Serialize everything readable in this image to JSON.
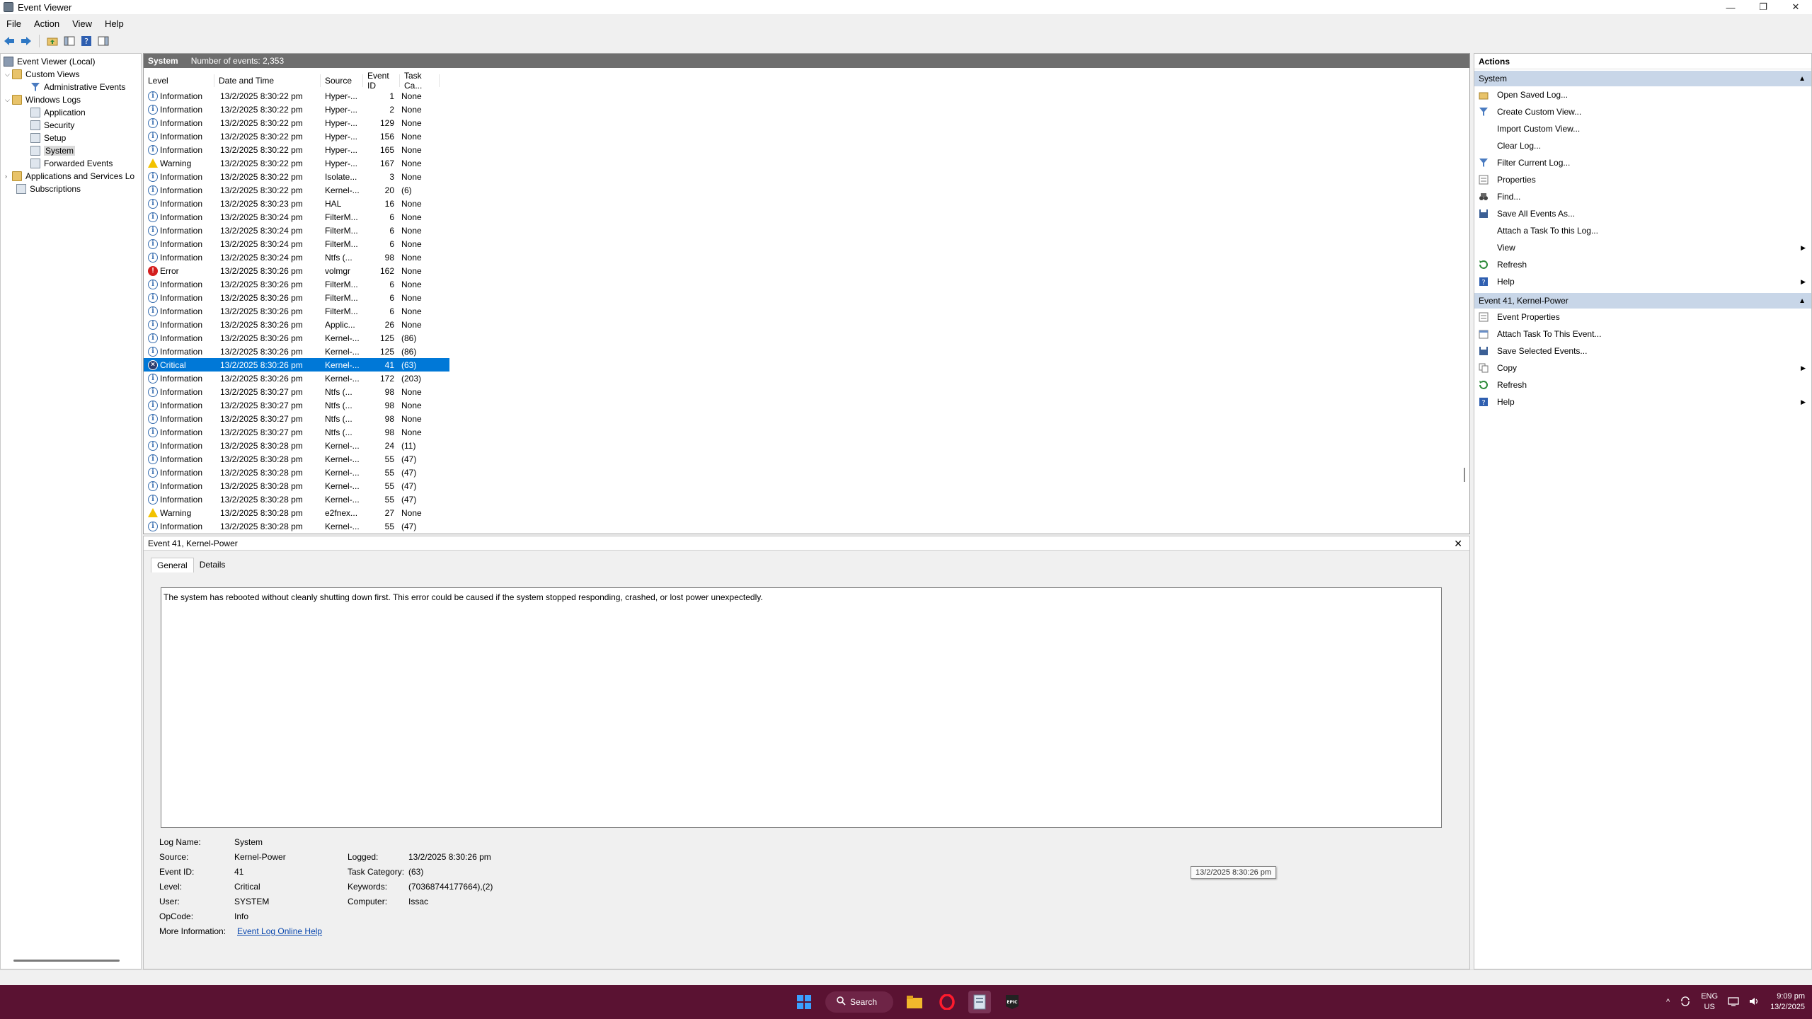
{
  "window": {
    "title": "Event Viewer",
    "minimize_glyph": "—",
    "maximize_glyph": "❐",
    "close_glyph": "✕"
  },
  "menu": [
    "File",
    "Action",
    "View",
    "Help"
  ],
  "toolbar_icons": [
    "back-arrow-icon",
    "forward-arrow-icon",
    "up-folder-icon",
    "show-hide-tree-icon",
    "help-icon",
    "show-hide-action-pane-icon"
  ],
  "tree": {
    "root": "Event Viewer (Local)",
    "custom_views": "Custom Views",
    "admin_events": "Administrative Events",
    "windows_logs": "Windows Logs",
    "application": "Application",
    "security": "Security",
    "setup": "Setup",
    "system": "System",
    "forwarded": "Forwarded Events",
    "apps_services": "Applications and Services Lo",
    "subscriptions": "Subscriptions"
  },
  "list": {
    "log_name": "System",
    "count_text": "Number of events: 2,353",
    "columns": [
      "Level",
      "Date and Time",
      "Source",
      "Event ID",
      "Task Ca..."
    ],
    "rows": [
      {
        "level": "Information",
        "date": "13/2/2025 8:30:22 pm",
        "source": "Hyper-...",
        "id": "1",
        "task": "None"
      },
      {
        "level": "Information",
        "date": "13/2/2025 8:30:22 pm",
        "source": "Hyper-...",
        "id": "2",
        "task": "None"
      },
      {
        "level": "Information",
        "date": "13/2/2025 8:30:22 pm",
        "source": "Hyper-...",
        "id": "129",
        "task": "None"
      },
      {
        "level": "Information",
        "date": "13/2/2025 8:30:22 pm",
        "source": "Hyper-...",
        "id": "156",
        "task": "None"
      },
      {
        "level": "Information",
        "date": "13/2/2025 8:30:22 pm",
        "source": "Hyper-...",
        "id": "165",
        "task": "None"
      },
      {
        "level": "Warning",
        "date": "13/2/2025 8:30:22 pm",
        "source": "Hyper-...",
        "id": "167",
        "task": "None"
      },
      {
        "level": "Information",
        "date": "13/2/2025 8:30:22 pm",
        "source": "Isolate...",
        "id": "3",
        "task": "None"
      },
      {
        "level": "Information",
        "date": "13/2/2025 8:30:22 pm",
        "source": "Kernel-...",
        "id": "20",
        "task": "(6)"
      },
      {
        "level": "Information",
        "date": "13/2/2025 8:30:23 pm",
        "source": "HAL",
        "id": "16",
        "task": "None"
      },
      {
        "level": "Information",
        "date": "13/2/2025 8:30:24 pm",
        "source": "FilterM...",
        "id": "6",
        "task": "None"
      },
      {
        "level": "Information",
        "date": "13/2/2025 8:30:24 pm",
        "source": "FilterM...",
        "id": "6",
        "task": "None"
      },
      {
        "level": "Information",
        "date": "13/2/2025 8:30:24 pm",
        "source": "FilterM...",
        "id": "6",
        "task": "None"
      },
      {
        "level": "Information",
        "date": "13/2/2025 8:30:24 pm",
        "source": "Ntfs (...",
        "id": "98",
        "task": "None"
      },
      {
        "level": "Error",
        "date": "13/2/2025 8:30:26 pm",
        "source": "volmgr",
        "id": "162",
        "task": "None"
      },
      {
        "level": "Information",
        "date": "13/2/2025 8:30:26 pm",
        "source": "FilterM...",
        "id": "6",
        "task": "None"
      },
      {
        "level": "Information",
        "date": "13/2/2025 8:30:26 pm",
        "source": "FilterM...",
        "id": "6",
        "task": "None"
      },
      {
        "level": "Information",
        "date": "13/2/2025 8:30:26 pm",
        "source": "FilterM...",
        "id": "6",
        "task": "None"
      },
      {
        "level": "Information",
        "date": "13/2/2025 8:30:26 pm",
        "source": "Applic...",
        "id": "26",
        "task": "None"
      },
      {
        "level": "Information",
        "date": "13/2/2025 8:30:26 pm",
        "source": "Kernel-...",
        "id": "125",
        "task": "(86)"
      },
      {
        "level": "Information",
        "date": "13/2/2025 8:30:26 pm",
        "source": "Kernel-...",
        "id": "125",
        "task": "(86)"
      },
      {
        "level": "Critical",
        "date": "13/2/2025 8:30:26 pm",
        "source": "Kernel-...",
        "id": "41",
        "task": "(63)",
        "selected": true
      },
      {
        "level": "Information",
        "date": "13/2/2025 8:30:26 pm",
        "source": "Kernel-...",
        "id": "172",
        "task": "(203)"
      },
      {
        "level": "Information",
        "date": "13/2/2025 8:30:27 pm",
        "source": "Ntfs (...",
        "id": "98",
        "task": "None"
      },
      {
        "level": "Information",
        "date": "13/2/2025 8:30:27 pm",
        "source": "Ntfs (...",
        "id": "98",
        "task": "None"
      },
      {
        "level": "Information",
        "date": "13/2/2025 8:30:27 pm",
        "source": "Ntfs (...",
        "id": "98",
        "task": "None"
      },
      {
        "level": "Information",
        "date": "13/2/2025 8:30:27 pm",
        "source": "Ntfs (...",
        "id": "98",
        "task": "None"
      },
      {
        "level": "Information",
        "date": "13/2/2025 8:30:28 pm",
        "source": "Kernel-...",
        "id": "24",
        "task": "(11)"
      },
      {
        "level": "Information",
        "date": "13/2/2025 8:30:28 pm",
        "source": "Kernel-...",
        "id": "55",
        "task": "(47)"
      },
      {
        "level": "Information",
        "date": "13/2/2025 8:30:28 pm",
        "source": "Kernel-...",
        "id": "55",
        "task": "(47)"
      },
      {
        "level": "Information",
        "date": "13/2/2025 8:30:28 pm",
        "source": "Kernel-...",
        "id": "55",
        "task": "(47)"
      },
      {
        "level": "Information",
        "date": "13/2/2025 8:30:28 pm",
        "source": "Kernel-...",
        "id": "55",
        "task": "(47)"
      },
      {
        "level": "Warning",
        "date": "13/2/2025 8:30:28 pm",
        "source": "e2fnex...",
        "id": "27",
        "task": "None"
      },
      {
        "level": "Information",
        "date": "13/2/2025 8:30:28 pm",
        "source": "Kernel-...",
        "id": "55",
        "task": "(47)"
      }
    ]
  },
  "detail": {
    "title": "Event 41, Kernel-Power",
    "tab_general": "General",
    "tab_details": "Details",
    "description": "The system has rebooted without cleanly shutting down first. This error could be caused if the system stopped responding, crashed, or lost power unexpectedly.",
    "labels": {
      "log_name": "Log Name:",
      "source": "Source:",
      "event_id": "Event ID:",
      "level": "Level:",
      "user": "User:",
      "opcode": "OpCode:",
      "more_info": "More Information:",
      "logged": "Logged:",
      "task_category": "Task Category:",
      "keywords": "Keywords:",
      "computer": "Computer:"
    },
    "values": {
      "log_name": "System",
      "source": "Kernel-Power",
      "event_id": "41",
      "level": "Critical",
      "user": "SYSTEM",
      "opcode": "Info",
      "more_info": "Event Log Online Help",
      "logged": "13/2/2025 8:30:26 pm",
      "task_category": "(63)",
      "keywords": "(70368744177664),(2)",
      "computer": "Issac"
    },
    "tooltip": "13/2/2025 8:30:26 pm"
  },
  "actions": {
    "title": "Actions",
    "section1": "System",
    "items1": [
      {
        "label": "Open Saved Log...",
        "icon": "open-folder-icon"
      },
      {
        "label": "Create Custom View...",
        "icon": "filter-icon"
      },
      {
        "label": "Import Custom View...",
        "icon": ""
      },
      {
        "label": "Clear Log...",
        "icon": ""
      },
      {
        "label": "Filter Current Log...",
        "icon": "filter-icon"
      },
      {
        "label": "Properties",
        "icon": "properties-icon"
      },
      {
        "label": "Find...",
        "icon": "binoculars-icon"
      },
      {
        "label": "Save All Events As...",
        "icon": "save-icon"
      },
      {
        "label": "Attach a Task To this Log...",
        "icon": ""
      },
      {
        "label": "View",
        "icon": "",
        "submenu": true
      },
      {
        "label": "Refresh",
        "icon": "refresh-icon"
      },
      {
        "label": "Help",
        "icon": "help-icon",
        "submenu": true
      }
    ],
    "section2": "Event 41, Kernel-Power",
    "items2": [
      {
        "label": "Event Properties",
        "icon": "properties-icon"
      },
      {
        "label": "Attach Task To This Event...",
        "icon": "task-icon"
      },
      {
        "label": "Save Selected Events...",
        "icon": "save-icon"
      },
      {
        "label": "Copy",
        "icon": "copy-icon",
        "submenu": true
      },
      {
        "label": "Refresh",
        "icon": "refresh-icon"
      },
      {
        "label": "Help",
        "icon": "help-icon",
        "submenu": true
      }
    ]
  },
  "taskbar": {
    "search_label": "Search",
    "lang_top": "ENG",
    "lang_bottom": "US",
    "time": "9:09 pm",
    "date": "13/2/2025",
    "caret_glyph": "^",
    "epic_text": "EPIC",
    "colors": {
      "taskbar_bg": "#5a1232",
      "selection": "#0078d7",
      "section_header": "#c8d6e8"
    }
  }
}
